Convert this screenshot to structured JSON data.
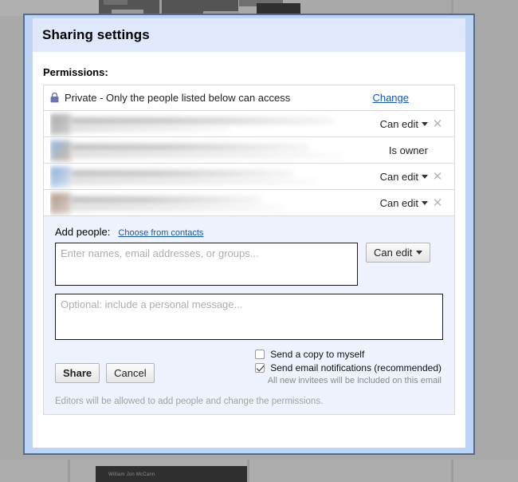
{
  "background": {
    "caption": "William Jon McCann"
  },
  "dialog": {
    "title": "Sharing settings",
    "permissions_label": "Permissions:",
    "visibility": {
      "icon": "lock-icon",
      "text": "Private - Only the people listed below can access",
      "change_label": "Change"
    },
    "people": [
      {
        "name": "",
        "role": "Can edit",
        "has_caret": true,
        "removable": true,
        "avatar_tint": "#8a8a8a"
      },
      {
        "name": "",
        "role": "Is owner",
        "has_caret": false,
        "removable": false,
        "avatar_tint": "#7aa8d4"
      },
      {
        "name": "",
        "role": "Can edit",
        "has_caret": true,
        "removable": true,
        "avatar_tint": "#6f9ed0"
      },
      {
        "name": "",
        "role": "Can edit",
        "has_caret": true,
        "removable": true,
        "avatar_tint": "#a08273"
      }
    ],
    "remove_icon": "✕",
    "add_people": {
      "label": "Add people:",
      "contacts_link": "Choose from contacts",
      "invite_placeholder": "Enter names, email addresses, or groups...",
      "invite_value": "",
      "role_button": "Can edit",
      "message_placeholder": "Optional: include a personal message...",
      "message_value": ""
    },
    "options": {
      "send_copy_label": "Send a copy to myself",
      "send_copy_checked": false,
      "notify_label": "Send email notifications (recommended)",
      "notify_checked": true,
      "hint": "All new invitees will be included on this email"
    },
    "share_button": "Share",
    "cancel_button": "Cancel",
    "footer_note": "Editors will be allowed to add people and change the permissions."
  },
  "colors": {
    "dialog_border": "#4f6b96",
    "title_bg": "#dfe9fb",
    "link": "#1155cc",
    "panel_bg": "#eef2fc"
  }
}
